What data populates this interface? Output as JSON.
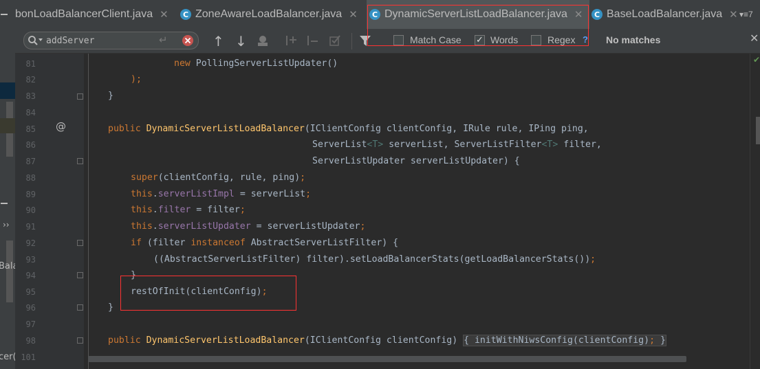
{
  "tabs": [
    {
      "label": "bonLoadBalancerClient.java",
      "icon": "java-class-icon",
      "active": false
    },
    {
      "label": "ZoneAwareLoadBalancer.java",
      "icon": "java-class-icon",
      "active": false
    },
    {
      "label": "DynamicServerListLoadBalancer.java",
      "icon": "java-class-icon",
      "active": true
    },
    {
      "label": "BaseLoadBalancer.java",
      "icon": "java-class-icon",
      "active": false
    }
  ],
  "tab_overflow": "▾≡7",
  "search": {
    "value": "addServer",
    "match_case_label": "Match Case",
    "match_case_checked": false,
    "words_label": "Words",
    "words_checked": true,
    "regex_label": "Regex",
    "regex_checked": false,
    "help": "?",
    "status": "No matches"
  },
  "left_strip": {
    "fragment_a": "Bala",
    "fragment_b": "cer(",
    "chevron": "››"
  },
  "gutter": {
    "override_marker": "@"
  },
  "line_numbers": [
    "81",
    "82",
    "83",
    "84",
    "85",
    "86",
    "87",
    "88",
    "89",
    "90",
    "91",
    "92",
    "93",
    "94",
    "95",
    "96",
    "97",
    "98",
    "101"
  ],
  "code": {
    "l81_kw": "new",
    "l81_rest": " PollingServerListUpdater()",
    "l82": ");",
    "l83": "}",
    "l85_kw": "public",
    "l85_fn": "DynamicServerListLoadBalancer",
    "l85_rest": "(IClientConfig clientConfig, IRule rule, IPing ping,",
    "l86_a": "ServerList",
    "l86_t1": "<T>",
    "l86_b": " serverList, ServerListFilter",
    "l86_t2": "<T>",
    "l86_c": " filter,",
    "l87": "ServerListUpdater serverListUpdater) {",
    "l88_kw": "super",
    "l88_rest": "(clientConfig, rule, ping)",
    "l88_semi": ";",
    "l89_kw": "this",
    "l89_dot": ".",
    "l89_fld": "serverListImpl",
    "l89_rest": " = serverList",
    "l89_semi": ";",
    "l90_kw": "this",
    "l90_dot": ".",
    "l90_fld": "filter",
    "l90_rest": " = filter",
    "l90_semi": ";",
    "l91_kw": "this",
    "l91_dot": ".",
    "l91_fld": "serverListUpdater",
    "l91_rest": " = serverListUpdater",
    "l91_semi": ";",
    "l92_kw": "if",
    "l92_a": " (filter ",
    "l92_kw2": "instanceof",
    "l92_b": " AbstractServerListFilter) {",
    "l93": "((AbstractServerListFilter) filter).setLoadBalancerStats(getLoadBalancerStats())",
    "l93_semi": ";",
    "l94": "}",
    "l95": "restOfInit(clientConfig)",
    "l95_semi": ";",
    "l96": "}",
    "l98_kw": "public",
    "l98_fn": "DynamicServerListLoadBalancer",
    "l98_rest": "(IClientConfig clientConfig)",
    "l98_body": "{ initWithNiwsConfig(clientConfig)",
    "l98_semi": ";",
    "l98_end": " }"
  },
  "colors": {
    "keyword": "#cc7832",
    "method": "#ffc66d",
    "field": "#9876aa",
    "type_param": "#507874",
    "text": "#a9b7c6",
    "annotation_box": "#ff3333"
  }
}
